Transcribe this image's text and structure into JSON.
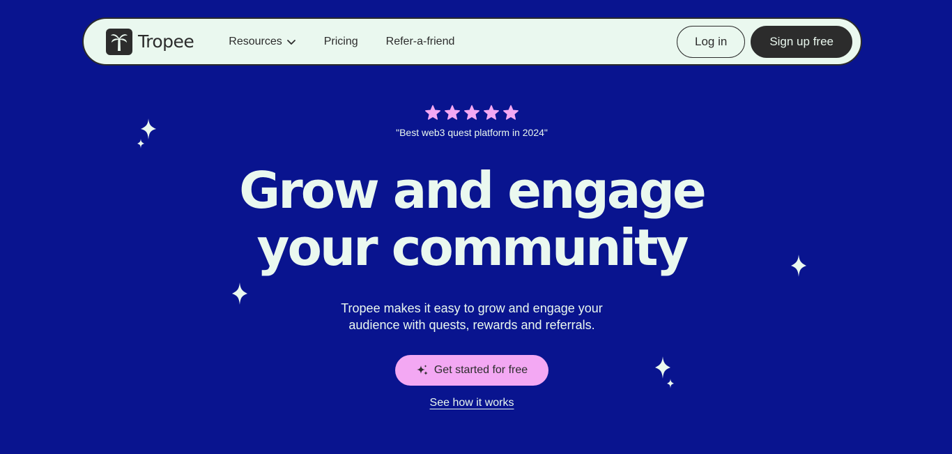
{
  "brand": {
    "name": "Tropee"
  },
  "nav": {
    "links": [
      {
        "label": "Resources"
      },
      {
        "label": "Pricing"
      },
      {
        "label": "Refer-a-friend"
      }
    ],
    "login_label": "Log in",
    "signup_label": "Sign up free"
  },
  "hero": {
    "rating": 5,
    "quote": "\"Best web3 quest platform in 2024\"",
    "headline_line1": "Grow and engage",
    "headline_line2": "your community",
    "subtitle_line1": "Tropee makes it easy to grow and engage your",
    "subtitle_line2": "audience with quests, rewards and referrals.",
    "cta_label": "Get started for free",
    "secondary_link": "See how it works"
  },
  "colors": {
    "background": "#09148f",
    "nav_bg": "#eaf8ef",
    "dark": "#2c2c2c",
    "accent_pink": "#f3a8f3",
    "text_light": "#eaf8ef"
  },
  "icons": {
    "logo": "palm-tree-icon",
    "dropdown": "chevron-down-icon",
    "star": "star-icon",
    "sparkle": "sparkle-icon"
  }
}
